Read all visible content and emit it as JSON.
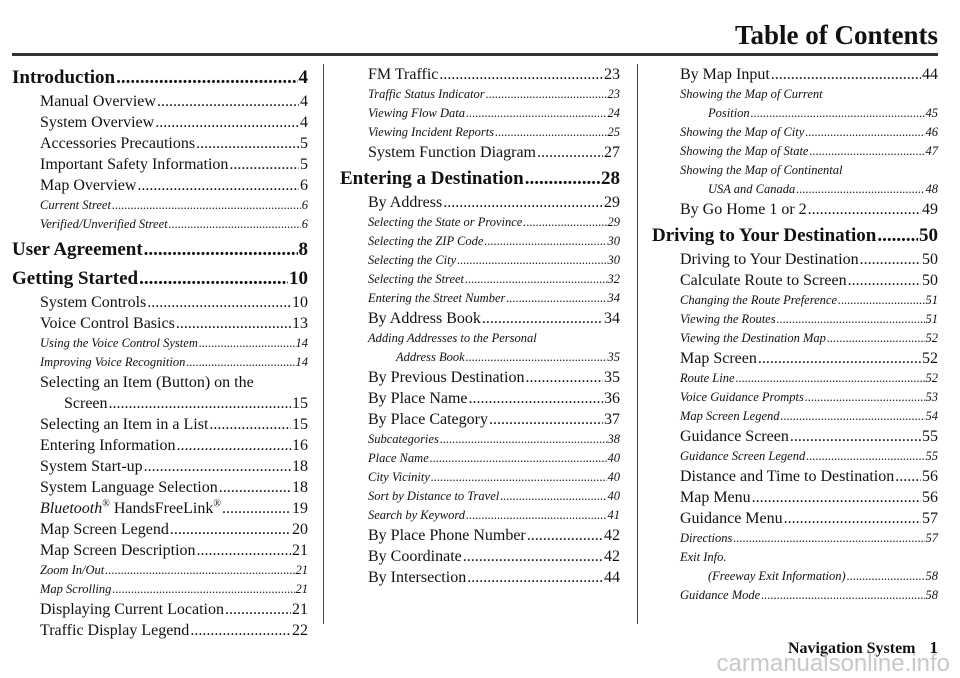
{
  "header": {
    "title": "Table of Contents"
  },
  "columns": [
    [
      {
        "l": "h",
        "t": "Introduction",
        "p": "4"
      },
      {
        "l": "m",
        "t": "Manual Overview",
        "p": "4"
      },
      {
        "l": "m",
        "t": "System Overview",
        "p": "4"
      },
      {
        "l": "m",
        "t": "Accessories Precautions",
        "p": "5"
      },
      {
        "l": "m",
        "t": "Important Safety Information",
        "p": "5"
      },
      {
        "l": "m",
        "t": "Map Overview",
        "p": "6"
      },
      {
        "l": "s",
        "t": "Current Street",
        "p": "6"
      },
      {
        "l": "s",
        "t": "Verified/Unverified Street",
        "p": "6"
      },
      {
        "l": "h",
        "t": "User Agreement",
        "p": "8"
      },
      {
        "l": "h",
        "t": "Getting Started",
        "p": "10"
      },
      {
        "l": "m",
        "t": "System Controls",
        "p": "10"
      },
      {
        "l": "m",
        "t": "Voice Control Basics",
        "p": "13"
      },
      {
        "l": "s",
        "t": "Using the Voice Control System",
        "p": "14"
      },
      {
        "l": "s",
        "t": "Improving Voice Recognition",
        "p": "14"
      },
      {
        "l": "m",
        "t": "Selecting an Item (Button) on the",
        "cont": "Screen",
        "p": "15"
      },
      {
        "l": "m",
        "t": "Selecting an Item in a List",
        "p": "15"
      },
      {
        "l": "m",
        "t": "Entering Information",
        "p": "16"
      },
      {
        "l": "m",
        "t": "System Start-up",
        "p": "18"
      },
      {
        "l": "m",
        "t": "System Language Selection",
        "p": "18"
      },
      {
        "l": "m",
        "t": "Bluetooth",
        "sup": "®",
        "t2": " HandsFreeLink",
        "sup2": "®",
        "p": "19",
        "bt": true
      },
      {
        "l": "m",
        "t": "Map Screen Legend",
        "p": "20"
      },
      {
        "l": "m",
        "t": "Map Screen Description",
        "p": "21"
      },
      {
        "l": "s",
        "t": "Zoom In/Out",
        "p": "21"
      },
      {
        "l": "s",
        "t": "Map Scrolling",
        "p": "21"
      },
      {
        "l": "m",
        "t": "Displaying Current Location",
        "p": "21"
      },
      {
        "l": "m",
        "t": "Traffic Display Legend",
        "p": "22"
      }
    ],
    [
      {
        "l": "m",
        "t": "FM Traffic",
        "p": "23",
        "top": true
      },
      {
        "l": "s",
        "t": "Traffic Status Indicator",
        "p": "23"
      },
      {
        "l": "s",
        "t": "Viewing Flow Data",
        "p": "24"
      },
      {
        "l": "s",
        "t": "Viewing Incident Reports",
        "p": "25"
      },
      {
        "l": "m",
        "t": "System Function Diagram",
        "p": "27"
      },
      {
        "l": "h",
        "t": "Entering a Destination",
        "p": "28"
      },
      {
        "l": "m",
        "t": "By Address",
        "p": "29"
      },
      {
        "l": "s",
        "t": "Selecting the State or Province",
        "p": "29"
      },
      {
        "l": "s",
        "t": "Selecting the ZIP Code",
        "p": "30"
      },
      {
        "l": "s",
        "t": "Selecting the City",
        "p": "30"
      },
      {
        "l": "s",
        "t": "Selecting the Street",
        "p": "32"
      },
      {
        "l": "s",
        "t": "Entering the Street Number",
        "p": "34"
      },
      {
        "l": "m",
        "t": "By Address Book",
        "p": "34"
      },
      {
        "l": "s",
        "t": "Adding Addresses to the Personal",
        "cont": "Address Book",
        "p": "35"
      },
      {
        "l": "m",
        "t": "By Previous Destination",
        "p": "35"
      },
      {
        "l": "m",
        "t": "By Place Name",
        "p": "36"
      },
      {
        "l": "m",
        "t": "By Place Category",
        "p": "37"
      },
      {
        "l": "s",
        "t": "Subcategories",
        "p": "38"
      },
      {
        "l": "s",
        "t": "Place Name",
        "p": "40"
      },
      {
        "l": "s",
        "t": "City Vicinity",
        "p": "40"
      },
      {
        "l": "s",
        "t": "Sort by Distance to Travel",
        "p": "40"
      },
      {
        "l": "s",
        "t": "Search by Keyword",
        "p": "41"
      },
      {
        "l": "m",
        "t": "By Place Phone Number",
        "p": "42"
      },
      {
        "l": "m",
        "t": "By Coordinate",
        "p": "42"
      },
      {
        "l": "m",
        "t": "By Intersection",
        "p": "44"
      }
    ],
    [
      {
        "l": "m",
        "t": "By Map Input",
        "p": "44",
        "top": true
      },
      {
        "l": "s",
        "t": "Showing the Map of Current",
        "cont": "Position",
        "p": "45"
      },
      {
        "l": "s",
        "t": "Showing the Map of City",
        "p": "46"
      },
      {
        "l": "s",
        "t": "Showing the Map of State",
        "p": "47"
      },
      {
        "l": "s",
        "t": "Showing the Map of Continental",
        "cont": "USA and Canada",
        "p": "48"
      },
      {
        "l": "m",
        "t": "By Go Home 1 or 2",
        "p": "49"
      },
      {
        "l": "h",
        "t": "Driving to Your Destination",
        "p": "50"
      },
      {
        "l": "m",
        "t": "Driving to Your Destination",
        "p": "50"
      },
      {
        "l": "m",
        "t": "Calculate Route to Screen",
        "p": "50"
      },
      {
        "l": "s",
        "t": "Changing the Route Preference",
        "p": "51"
      },
      {
        "l": "s",
        "t": "Viewing the Routes",
        "p": "51"
      },
      {
        "l": "s",
        "t": "Viewing the Destination Map",
        "p": "52"
      },
      {
        "l": "m",
        "t": "Map Screen",
        "p": "52"
      },
      {
        "l": "s",
        "t": "Route Line",
        "p": "52"
      },
      {
        "l": "s",
        "t": "Voice Guidance Prompts",
        "p": "53"
      },
      {
        "l": "s",
        "t": "Map Screen Legend",
        "p": "54"
      },
      {
        "l": "m",
        "t": "Guidance Screen",
        "p": "55"
      },
      {
        "l": "s",
        "t": "Guidance Screen Legend",
        "p": "55"
      },
      {
        "l": "m",
        "t": "Distance and Time to Destination",
        "p": "56"
      },
      {
        "l": "m",
        "t": "Map Menu",
        "p": "56"
      },
      {
        "l": "m",
        "t": "Guidance Menu",
        "p": "57"
      },
      {
        "l": "s",
        "t": "Directions",
        "p": "57"
      },
      {
        "l": "s",
        "t": "Exit Info.",
        "cont": "(Freeway Exit Information)",
        "p": "58"
      },
      {
        "l": "s",
        "t": "Guidance Mode",
        "p": "58"
      }
    ]
  ],
  "footer": {
    "section": "Navigation System",
    "page": "1"
  },
  "watermark": "carmanualsonline.info"
}
